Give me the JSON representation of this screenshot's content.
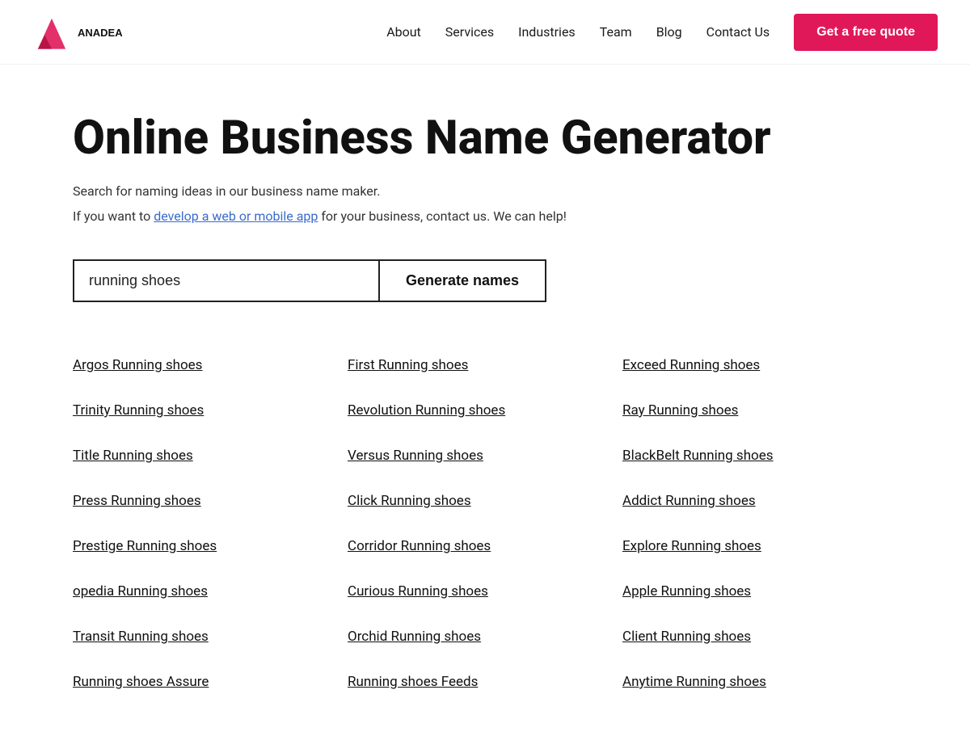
{
  "header": {
    "logo_text": "ANADEA",
    "nav_items": [
      {
        "label": "About",
        "href": "#"
      },
      {
        "label": "Services",
        "href": "#"
      },
      {
        "label": "Industries",
        "href": "#"
      },
      {
        "label": "Team",
        "href": "#"
      },
      {
        "label": "Blog",
        "href": "#"
      },
      {
        "label": "Contact Us",
        "href": "#"
      }
    ],
    "cta_label": "Get a free quote"
  },
  "hero": {
    "title": "Online Business Name Generator",
    "subtitle1": "Search for naming ideas in our business name maker.",
    "subtitle2_before": "If you want to ",
    "subtitle2_link": "develop a web or mobile app",
    "subtitle2_after": " for your business, contact us. We can help!"
  },
  "search": {
    "input_value": "running shoes",
    "button_label": "Generate names"
  },
  "results": {
    "col1": [
      "Argos Running shoes",
      "Trinity Running shoes",
      "Title Running shoes",
      "Press Running shoes",
      "Prestige Running shoes",
      "opedia Running shoes",
      "Transit Running shoes",
      "Running shoes Assure"
    ],
    "col2": [
      "First Running shoes",
      "Revolution Running shoes",
      "Versus Running shoes",
      "Click Running shoes",
      "Corridor Running shoes",
      "Curious Running shoes",
      "Orchid Running shoes",
      "Running shoes Feeds"
    ],
    "col3": [
      "Exceed Running shoes",
      "Ray Running shoes",
      "BlackBelt Running shoes",
      "Addict Running shoes",
      "Explore Running shoes",
      "Apple Running shoes",
      "Client Running shoes",
      "Anytime Running shoes"
    ]
  },
  "colors": {
    "accent": "#e0185a",
    "link_blue": "#3a6bcc"
  }
}
